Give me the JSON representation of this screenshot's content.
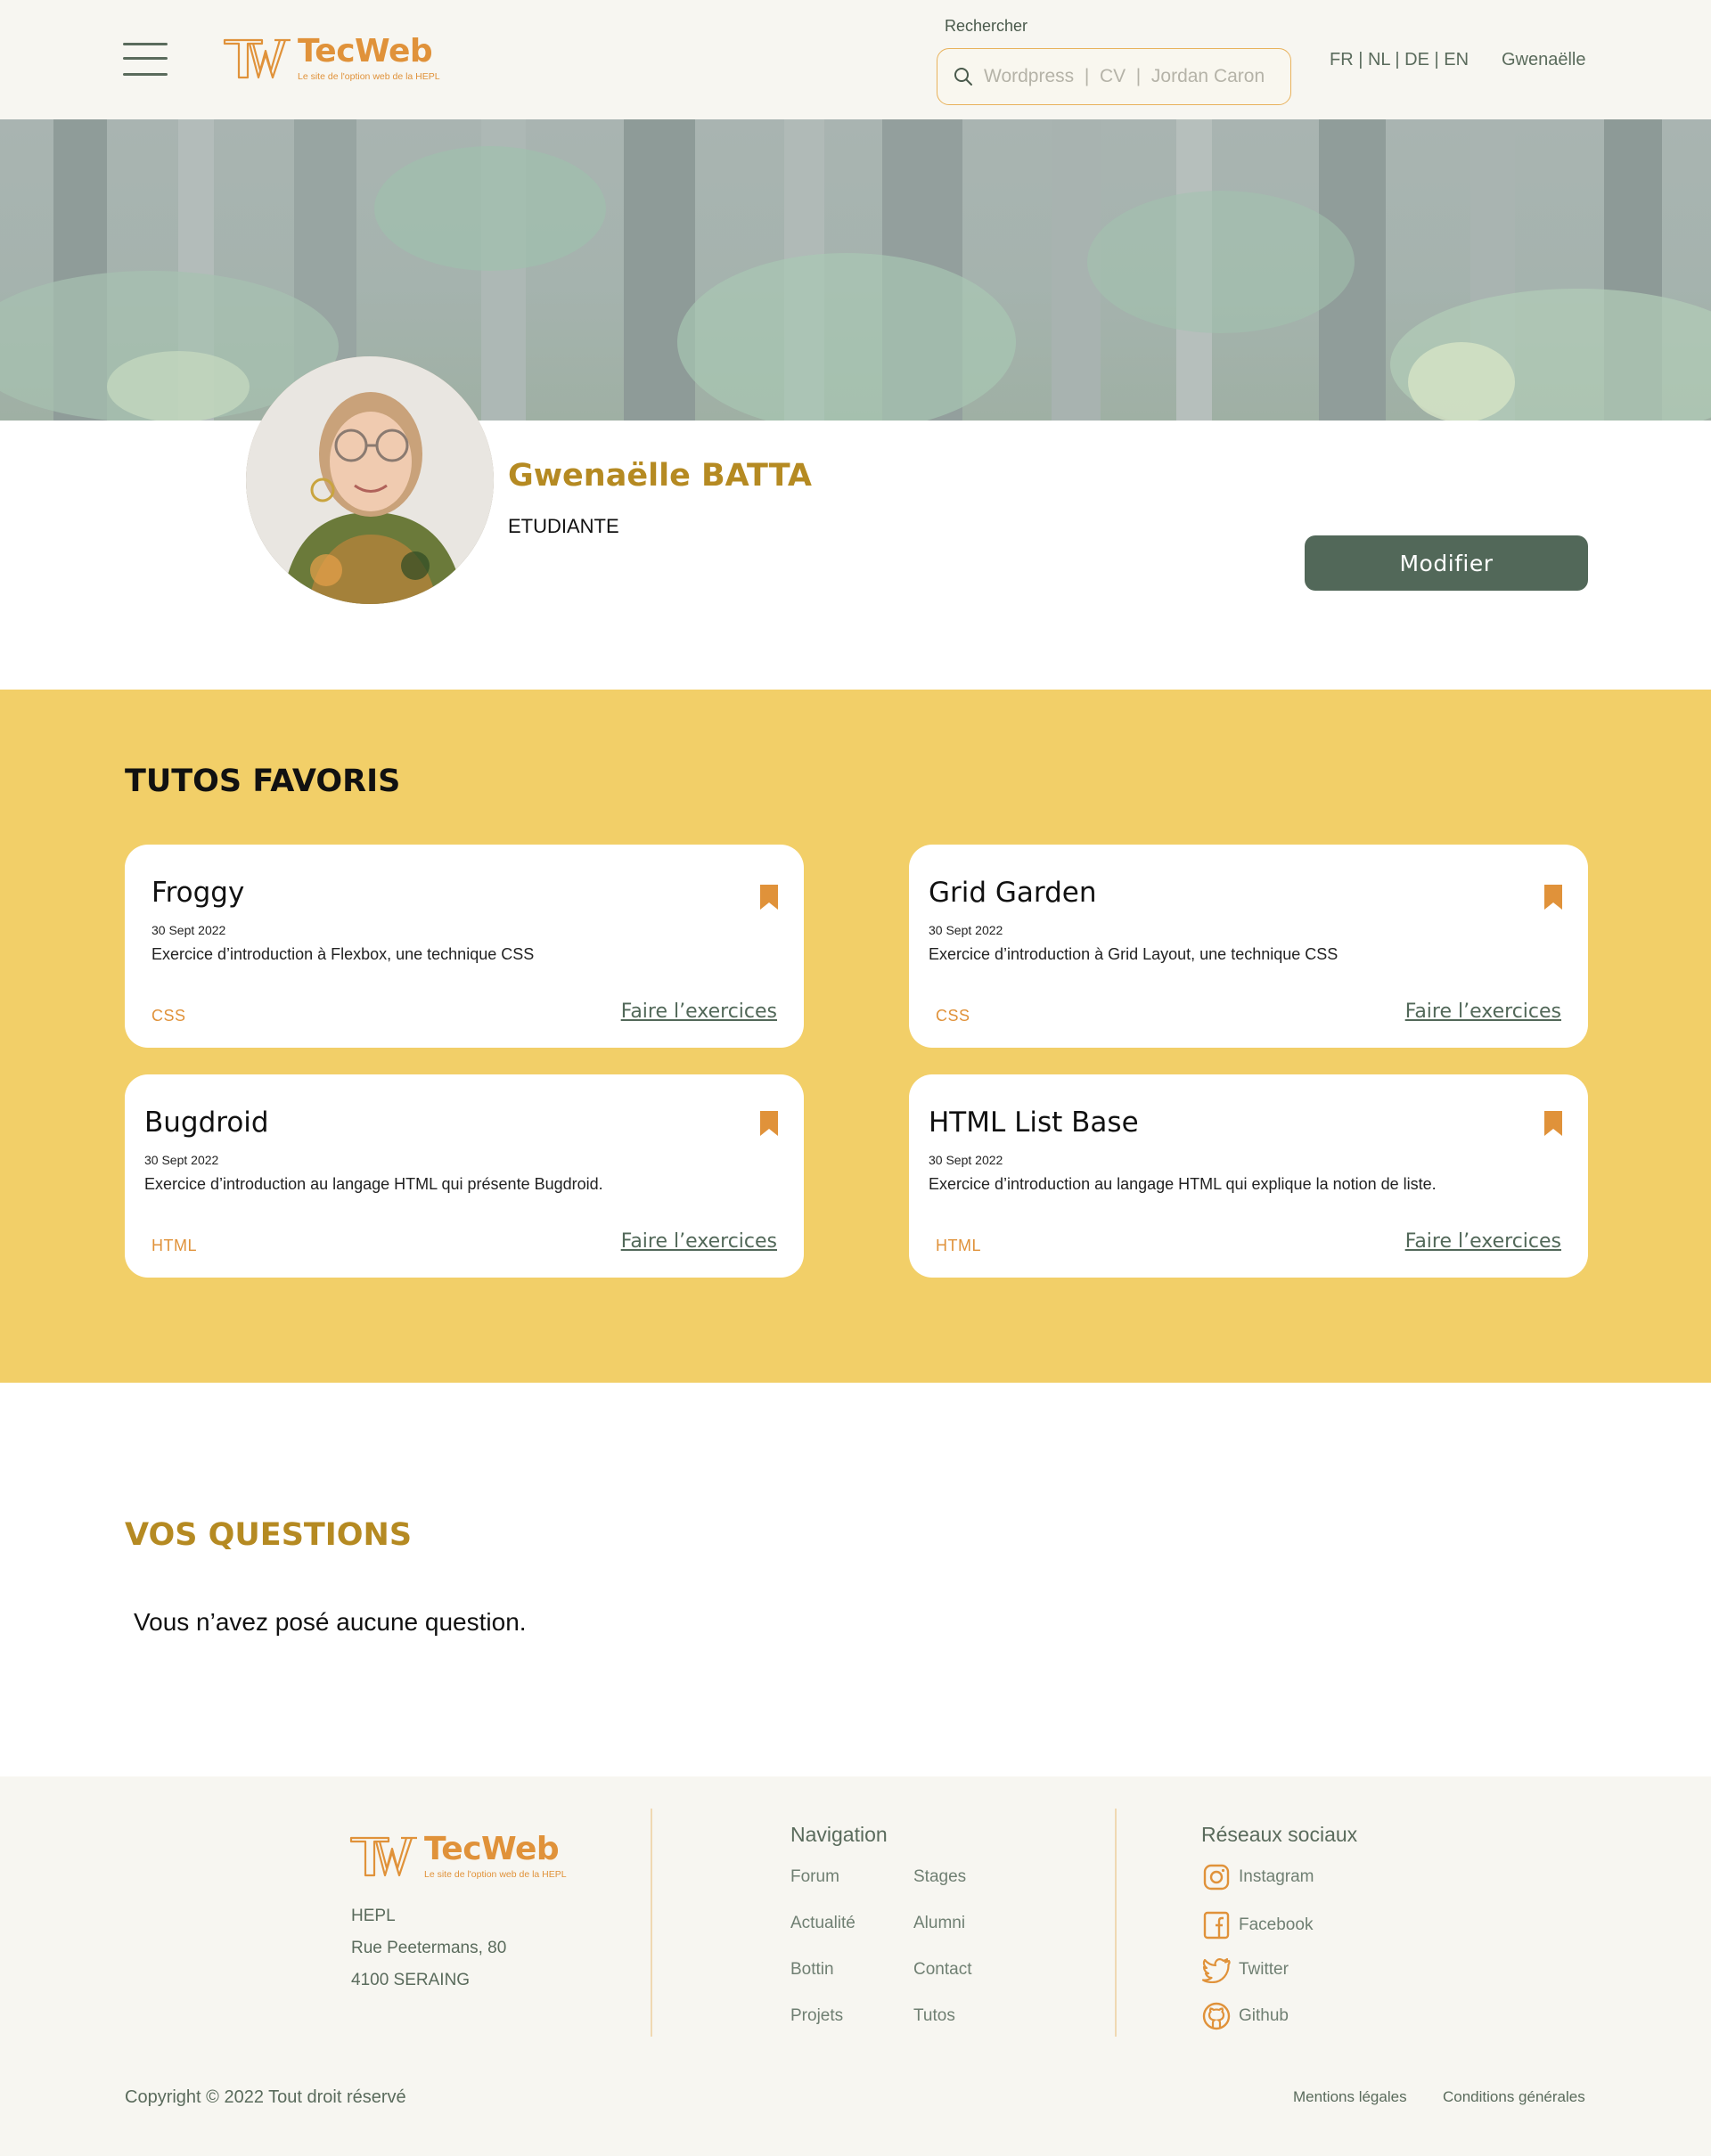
{
  "header": {
    "menu_icon": "hamburger-icon",
    "logo": {
      "name": "TecWeb",
      "tagline": "Le site de l'option web de la HEPL"
    },
    "search": {
      "label": "Rechercher",
      "placeholder": "Wordpress  |  CV  |  Jordan Caron",
      "icon": "search-icon"
    },
    "languages": [
      "FR",
      "NL",
      "DE",
      "EN"
    ],
    "user_name": "Gwenaëlle"
  },
  "profile": {
    "name": "Gwenaëlle BATTA",
    "role": "ETUDIANTE",
    "modify_label": "Modifier"
  },
  "favorites": {
    "title": "TUTOS FAVORIS",
    "cards": [
      {
        "title": "Froggy",
        "date": "30 Sept 2022",
        "description": "Exercice d’introduction à Flexbox, une technique CSS",
        "tag": "CSS",
        "link": "Faire l’exercices"
      },
      {
        "title": "Grid Garden",
        "date": "30 Sept 2022",
        "description": "Exercice d’introduction à Grid Layout, une technique CSS",
        "tag": "CSS",
        "link": "Faire l’exercices"
      },
      {
        "title": "Bugdroid",
        "date": "30 Sept 2022",
        "description": "Exercice d’introduction au langage HTML qui présente Bugdroid.",
        "tag": "HTML",
        "link": "Faire l’exercices"
      },
      {
        "title": "HTML List Base",
        "date": "30 Sept 2022",
        "description": "Exercice d’introduction au langage HTML qui explique la notion de liste.",
        "tag": "HTML",
        "link": "Faire l’exercices"
      }
    ]
  },
  "questions": {
    "title": "VOS QUESTIONS",
    "empty_message": "Vous n’avez posé aucune question."
  },
  "footer": {
    "logo": {
      "name": "TecWeb",
      "tagline": "Le site de l'option web de la HEPL"
    },
    "address": [
      "HEPL",
      "Rue Peetermans, 80",
      "4100 SERAING"
    ],
    "navigation": {
      "title": "Navigation",
      "links": [
        "Forum",
        "Stages",
        "Actualité",
        "Alumni",
        "Bottin",
        "Contact",
        "Projets",
        "Tutos"
      ]
    },
    "social": {
      "title": "Réseaux sociaux",
      "links": [
        {
          "label": "Instagram",
          "icon": "instagram-icon"
        },
        {
          "label": "Facebook",
          "icon": "facebook-icon"
        },
        {
          "label": "Twitter",
          "icon": "twitter-icon"
        },
        {
          "label": "Github",
          "icon": "github-icon"
        }
      ]
    },
    "copyright": "Copyright © 2022 Tout droit réservé",
    "legal_links": [
      "Mentions légales",
      "Conditions générales"
    ]
  },
  "colors": {
    "accent_orange": "#e0923a",
    "gold_heading": "#b58a22",
    "favorites_bg": "#f2cf68",
    "button_green": "#526859",
    "text_green": "#5a6b5c"
  }
}
